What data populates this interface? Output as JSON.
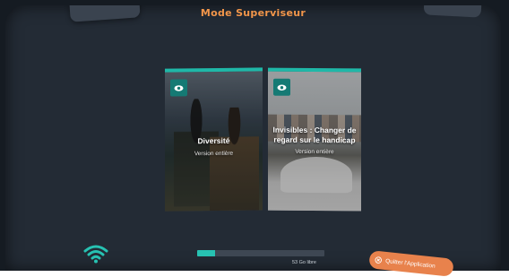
{
  "header": {
    "title": "Mode Superviseur",
    "left_tab_label": "",
    "right_tab_label": ""
  },
  "cards": [
    {
      "title": "Diversité",
      "subtitle": "Version entière",
      "icon": "eye-icon"
    },
    {
      "title": "Invisibles : Changer de regard sur le handicap",
      "subtitle": "Version entière",
      "icon": "eye-icon"
    }
  ],
  "footer": {
    "wifi_icon": "wifi-icon",
    "progress": 0.14,
    "storage_text": "53 Go libre",
    "quit_label": "Quitter l'Application",
    "quit_icon": "close-circle-icon"
  },
  "colors": {
    "accent": "#1fb8a8",
    "title": "#f2964a",
    "quit_button": "#e8824c",
    "panel": "#232b35"
  }
}
